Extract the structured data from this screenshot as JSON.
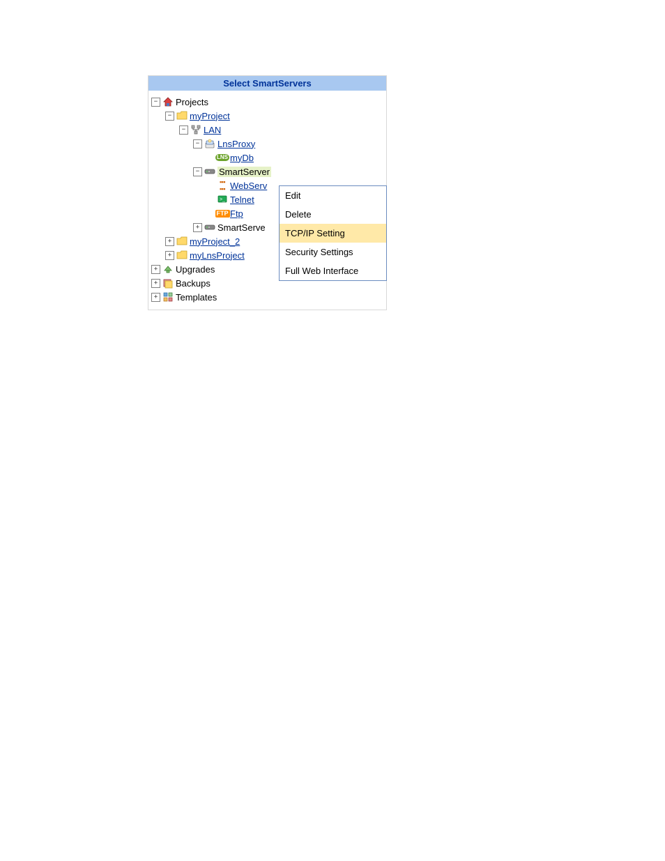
{
  "header": {
    "title": "Select SmartServers"
  },
  "tree": {
    "projects": {
      "label": "Projects",
      "myProject": {
        "label": "myProject",
        "lan": {
          "label": "LAN",
          "lnsProxy": {
            "label": "LnsProxy",
            "myDb": {
              "label": "myDb"
            }
          },
          "smartServer": {
            "label": "SmartServer",
            "webServer": {
              "label": "WebServ"
            },
            "telnet": {
              "label": "Telnet"
            },
            "ftp": {
              "label": "Ftp"
            }
          },
          "smartServer2": {
            "label": "SmartServe"
          }
        }
      },
      "myProject2": {
        "label": "myProject_2"
      },
      "myLnsProject": {
        "label": "myLnsProject"
      }
    },
    "upgrades": {
      "label": "Upgrades"
    },
    "backups": {
      "label": "Backups"
    },
    "templates": {
      "label": "Templates"
    }
  },
  "contextMenu": {
    "edit": "Edit",
    "delete": "Delete",
    "tcpip": "TCP/IP Setting",
    "security": "Security Settings",
    "fullWeb": "Full Web Interface"
  },
  "glyphs": {
    "minus": "−",
    "plus": "+"
  }
}
